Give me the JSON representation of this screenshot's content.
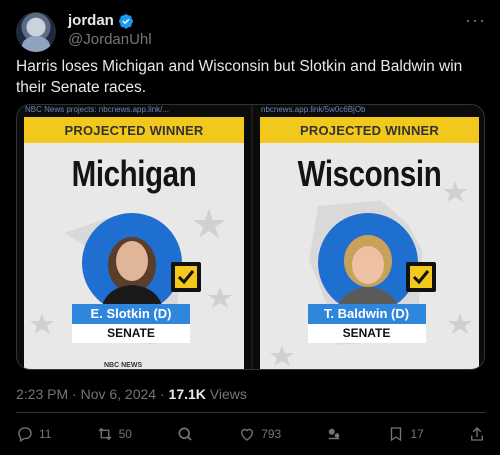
{
  "author": {
    "display_name": "jordan",
    "handle": "@JordanUhl"
  },
  "tweet_text": "Harris loses Michigan and Wisconsin but Slotkin and Baldwin win their Senate races.",
  "media": {
    "left": {
      "link_text": "NBC News projects: nbcnews.app.link/...",
      "banner": "PROJECTED WINNER",
      "state": "Michigan",
      "candidate": "E. Slotkin (D)",
      "office": "SENATE",
      "brand": "NBC NEWS"
    },
    "right": {
      "link_text": "nbcnews.app.link/5w0c6BjOb",
      "banner": "PROJECTED WINNER",
      "state": "Wisconsin",
      "candidate": "T. Baldwin (D)",
      "office": "SENATE"
    }
  },
  "timestamp": "2:23 PM · Nov 6, 2024 · ",
  "views_count": "17.1K",
  "views_label": " Views",
  "actions": {
    "replies": "11",
    "reposts": "50",
    "likes": "793",
    "bookmarks": "17"
  },
  "colors": {
    "background": "#000000",
    "text": "#e7e9ea",
    "muted": "#71767b",
    "verified": "#1d9bf0",
    "banner_yellow": "#f3c81c",
    "candidate_blue": "#2f86dd"
  }
}
